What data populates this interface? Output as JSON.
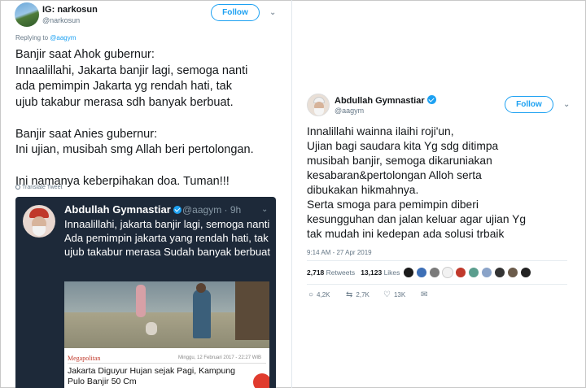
{
  "left_tweet": {
    "display_name": "IG: narkosun",
    "handle": "@narkosun",
    "follow_label": "Follow",
    "replying_prefix": "Replying to ",
    "replying_to": "@aagym",
    "text": "Banjir saat Ahok gubernur:\nInnaalillahi, Jakarta banjir lagi, semoga nanti\nada pemimpin Jakarta yg rendah hati, tak\nujub takabur merasa sdh banyak berbuat.\n\nBanjir saat Anies gubernur:\nIni ujian, musibah smg Allah beri pertolongan.\n\nIni namanya keberpihakan doa. Tuman!!!",
    "translate_label": "Translate Tweet",
    "embedded": {
      "display_name": "Abdullah Gymnastiar",
      "handle": "@aagym · 9h",
      "text": "Innaalillahi, jakarta banjir lagi, semoga nanti Ada pemimpin jakarta yang rendah hati, tak ujub takabur merasa Sudah banyak berbuat",
      "news_section": "Megapolitan",
      "news_date": "Minggu, 12 Februari 2017 - 22:27 WIB",
      "news_title": "Jakarta Diguyur Hujan sejak Pagi, Kampung Pulo Banjir 50 Cm"
    }
  },
  "right_tweet": {
    "display_name": "Abdullah Gymnastiar",
    "handle": "@aagym",
    "follow_label": "Follow",
    "text_lines": [
      "Innalillahi wainna ilaihi roji'un,",
      "Ujian bagi saudara kita Yg sdg ditimpa",
      "musibah banjir, semoga dikaruniakan",
      "kesabaran&pertolongan Alloh serta",
      "dibukakan hikmahnya.",
      "Serta smoga para pemimpin diberi",
      "kesungguhan dan jalan keluar agar ujian Yg",
      "tak mudah ini kedepan ada solusi trbaik"
    ],
    "timestamp": "9:14 AM - 27 Apr 2019",
    "retweets_count": "2,718",
    "retweets_label": "Retweets",
    "likes_count": "13,123",
    "likes_label": "Likes",
    "liker_colors": [
      "#1b1b1b",
      "#3d6fb6",
      "#7a7a7a",
      "#f2f2f2",
      "#c0392b",
      "#5b9e8e",
      "#8aa3c8",
      "#333333",
      "#6b5b4b",
      "#222222"
    ],
    "actions": {
      "reply_count": "4,2K",
      "retweet_count": "2,7K",
      "like_count": "13K"
    }
  },
  "colors": {
    "twitter_blue": "#1da1f2",
    "embed_bg": "#1d2939"
  }
}
